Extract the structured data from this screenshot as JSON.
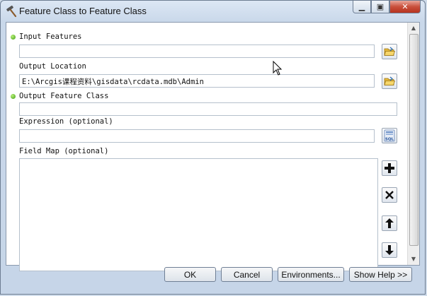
{
  "window": {
    "title": "Feature Class to Feature Class"
  },
  "form": {
    "input_features": {
      "label": "Input Features",
      "value": ""
    },
    "output_location": {
      "label": "Output Location",
      "value": "E:\\Arcgis课程资料\\gisdata\\rcdata.mdb\\Admin"
    },
    "output_feature_class": {
      "label": "Output Feature Class",
      "value": ""
    },
    "expression": {
      "label": "Expression (optional)",
      "value": ""
    },
    "field_map": {
      "label": "Field Map (optional)"
    }
  },
  "sql_button_text": "SQL",
  "buttons": {
    "ok": "OK",
    "cancel": "Cancel",
    "environments": "Environments...",
    "show_help": "Show Help >>"
  },
  "icons": [
    "hammer-icon",
    "minimize-icon",
    "maximize-icon",
    "close-icon",
    "folder-open-icon",
    "sql-icon",
    "add-icon",
    "delete-icon",
    "move-up-icon",
    "move-down-icon"
  ]
}
